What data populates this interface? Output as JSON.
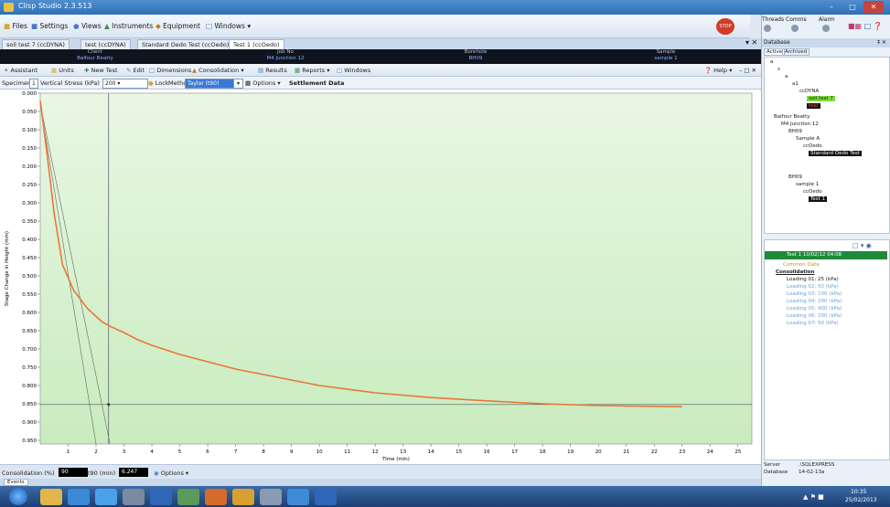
{
  "window": {
    "title": "Clisp Studio 2.3.513"
  },
  "menu": [
    {
      "label": "Files",
      "icon": "folder-icon"
    },
    {
      "label": "Settings",
      "icon": "settings-icon"
    },
    {
      "label": "Views",
      "icon": "views-icon"
    },
    {
      "label": "Instruments",
      "icon": "instruments-icon"
    },
    {
      "label": "Equipment",
      "icon": "equipment-icon"
    },
    {
      "label": "Windows",
      "icon": "windows-icon"
    }
  ],
  "panel_indicators": {
    "threads": "Threads",
    "comms": "Comms",
    "alarm": "Alarm"
  },
  "doc_tabs": [
    {
      "label": "soil test 7 (ccDYNA)"
    },
    {
      "label": "test (ccDYNA)"
    },
    {
      "label": "Standard Oedo Test (ccOedo)"
    },
    {
      "label": "Test 1 (ccOedo)"
    }
  ],
  "info": {
    "client_header": "Client",
    "client": "Balfour Beatty",
    "job_header": "Job No",
    "job": "M4 Junction 12",
    "borehole_header": "Borehole",
    "borehole": "BH09",
    "sample_header": "Sample",
    "sample": "sample 1"
  },
  "toolbar": {
    "assistant": "Assistant",
    "units": "Units",
    "new_test": "New Test",
    "edit": "Edit",
    "dimensions": "Dimensions",
    "consolidation": "Consolidation",
    "results": "Results",
    "reports": "Reports",
    "windows": "Windows",
    "help": "Help"
  },
  "toolbar2": {
    "specimen_label": "Specimen",
    "specimen_value": "1",
    "stress_label": "Vertical Stress (kPa)",
    "stress_value": "200",
    "lock": "Lock",
    "method_label": "Method",
    "method_value": "Taylor (t90)",
    "options": "Options",
    "view_title": "Settlement Data"
  },
  "status": {
    "label": "Consolidation (%)",
    "percent": "90",
    "t_label": "t90 (min)",
    "t_value": "6.247",
    "options": "Options"
  },
  "events_tab": "Events",
  "right_panel": {
    "title": "Database",
    "tab_active": "Active",
    "tab_archived": "Archived",
    "tree": [
      {
        "label": "a"
      },
      {
        "label": "s"
      },
      {
        "label": "a"
      },
      {
        "label": "a1"
      },
      {
        "label": "ccDYNA"
      },
      {
        "label": "soil test 7"
      },
      {
        "label": "test"
      },
      {
        "label": "Balfour Beatty"
      },
      {
        "label": "M4 Junction 12"
      },
      {
        "label": "BH09"
      },
      {
        "label": "Sample A"
      },
      {
        "label": "ccOedo"
      },
      {
        "label": "Standard Oedo Test"
      },
      {
        "label": "BH09"
      },
      {
        "label": "sample 1"
      },
      {
        "label": "ccOedo"
      },
      {
        "label": "Test 1"
      }
    ],
    "test_title": "Test 1  10/02/12 04:08",
    "common": "Common Data",
    "consolidation_header": "Consolidation",
    "loadings": [
      "Loading 01: 25 (kPa)",
      "Loading 02: 50 (kPa)",
      "Loading 03: 100 (kPa)",
      "Loading 04: 200 (kPa)",
      "Loading 05: 400 (kPa)",
      "Loading 06: 200 (kPa)",
      "Loading 07: 50 (kPa)"
    ],
    "server_label": "Server",
    "server": ".\\SQLEXPRESS",
    "database_label": "Database",
    "database": "14-02-13a"
  },
  "taskbar": {
    "time": "10:35",
    "date": "25/02/2013"
  },
  "colors": {
    "curve": "#e8773a",
    "plot_bg_top": "#e9f7e4",
    "plot_bg_bottom": "#c9ecbe"
  },
  "chart_data": {
    "type": "line",
    "xlabel": "Time (min)",
    "ylabel": "Stage Change in Height (mm)",
    "xlim": [
      0,
      25.5
    ],
    "ylim": [
      0,
      0.96
    ],
    "y_inverted": true,
    "grid": false,
    "xticks": [
      "1",
      "2",
      "3",
      "4",
      "5",
      "6",
      "7",
      "8",
      "9",
      "10",
      "11",
      "12",
      "13",
      "14",
      "15",
      "16",
      "17",
      "18",
      "19",
      "20",
      "21",
      "22",
      "23",
      "24",
      "25"
    ],
    "yticks": [
      "0.000",
      "0.050",
      "0.100",
      "0.150",
      "0.200",
      "0.250",
      "0.300",
      "0.350",
      "0.400",
      "0.450",
      "0.500",
      "0.550",
      "0.600",
      "0.650",
      "0.700",
      "0.750",
      "0.800",
      "0.850",
      "0.900",
      "0.950"
    ],
    "series": [
      {
        "x": [
          0,
          0.25,
          0.5,
          0.8,
          1.2,
          1.7,
          2.2,
          2.5,
          3,
          3.5,
          4,
          5,
          6,
          7,
          8,
          9,
          10,
          12,
          14,
          16,
          18,
          20,
          22,
          23
        ],
        "y": [
          0.02,
          0.17,
          0.33,
          0.47,
          0.54,
          0.59,
          0.625,
          0.638,
          0.655,
          0.675,
          0.69,
          0.715,
          0.735,
          0.755,
          0.77,
          0.785,
          0.8,
          0.82,
          0.833,
          0.842,
          0.85,
          0.855,
          0.857,
          0.858
        ]
      }
    ],
    "tangent_lines": [
      {
        "x": [
          0,
          2.0
        ],
        "y": [
          0.03,
          0.96
        ]
      },
      {
        "x": [
          0,
          2.5
        ],
        "y": [
          0.03,
          0.96
        ]
      }
    ],
    "t90_x": 2.45,
    "final_y": 0.852
  }
}
